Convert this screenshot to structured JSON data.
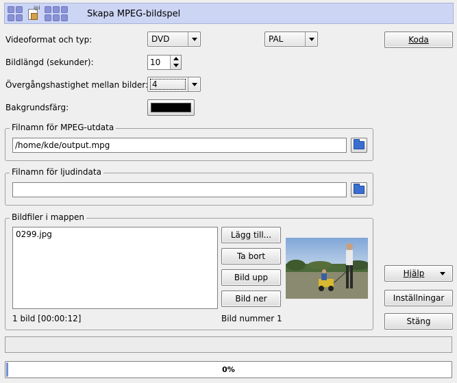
{
  "window": {
    "title": "Skapa MPEG-bildspel"
  },
  "form": {
    "video_format_label": "Videoformat och typ:",
    "video_format_value": "DVD",
    "video_type_value": "PAL",
    "image_length_label": "Bildlängd (sekunder):",
    "image_length_value": "10",
    "transition_label": "Övergångshastighet mellan bilder:",
    "transition_value": "4",
    "background_label": "Bakgrundsfärg:",
    "background_color": "#000000"
  },
  "mpeg_output": {
    "group_title": "Filnamn för MPEG-utdata",
    "path_value": "/home/kde/output.mpg"
  },
  "audio": {
    "group_title": "Filnamn för ljudindata",
    "path_value": ""
  },
  "images": {
    "group_title": "Bildfiler i mappen",
    "files": [
      "0299.jpg"
    ],
    "add_label": "Lägg till...",
    "remove_label": "Ta bort",
    "up_label": "Bild upp",
    "down_label": "Bild ner",
    "summary": "1 bild [00:00:12]",
    "image_number": "Bild nummer 1"
  },
  "buttons": {
    "encode": "Koda",
    "help": "Hjälp",
    "settings": "Inställningar",
    "close": "Stäng"
  },
  "status": {
    "text": ""
  },
  "progress": {
    "value": 0,
    "label": "0%"
  },
  "colors": {
    "header_bg": "#ccd5f4",
    "window_bg": "#efefef",
    "progress_fill": "#6f8fd0"
  }
}
